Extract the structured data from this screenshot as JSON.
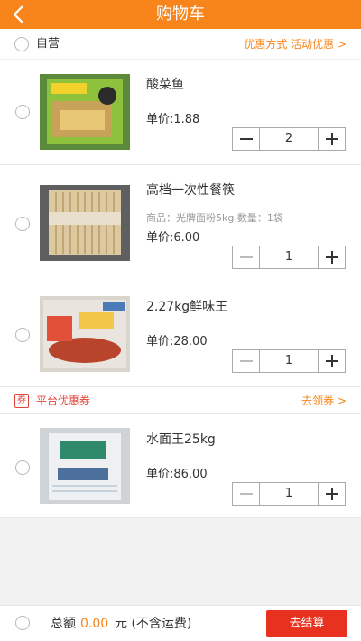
{
  "header": {
    "title": "购物车",
    "back_icon": "chevron-left-icon"
  },
  "store": {
    "name": "自营",
    "promo": "优惠方式  活动优惠 >"
  },
  "items": [
    {
      "name": "酸菜鱼",
      "spec": "",
      "price": "单价:1.88",
      "qty": "2"
    },
    {
      "name": "高档一次性餐筷",
      "spec": "商品：光牌面粉5kg 数量：1袋",
      "price": "单价:6.00",
      "qty": "1"
    },
    {
      "name": "2.27kg鲜味王",
      "spec": "",
      "price": "单价:28.00",
      "qty": "1"
    },
    {
      "name": "水面王25kg",
      "spec": "",
      "price": "单价:86.00",
      "qty": "1"
    }
  ],
  "coupon": {
    "icon_text": "券",
    "label": "平台优惠券",
    "link": "去领券 >"
  },
  "footer": {
    "total_label": "总额",
    "total_amount": "0.00",
    "total_unit": "元 (不含运费)",
    "checkout_label": "去结算"
  },
  "colors": {
    "accent": "#f7851b",
    "checkout": "#e8321f",
    "coupon": "#e0453a"
  }
}
